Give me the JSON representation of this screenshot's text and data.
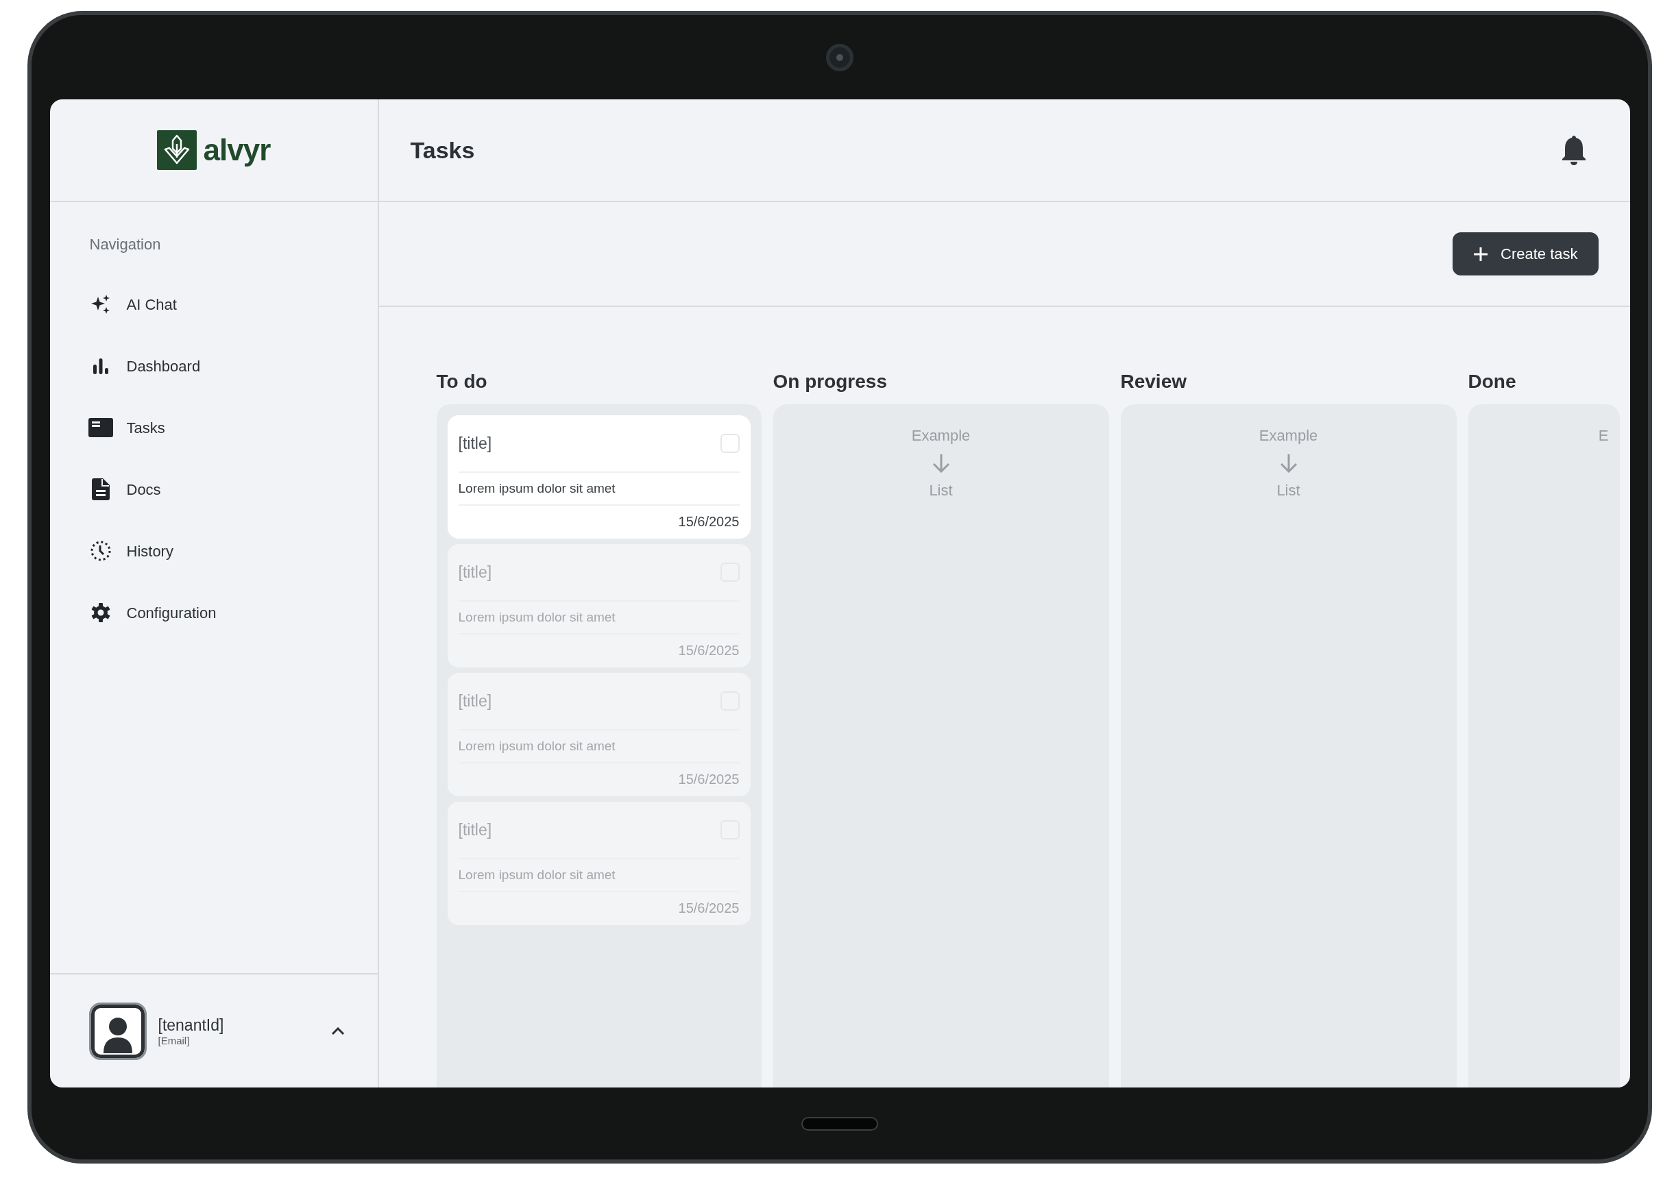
{
  "logo": {
    "text": "alvyr"
  },
  "sidebar": {
    "section_label": "Navigation",
    "items": [
      {
        "label": "AI Chat"
      },
      {
        "label": "Dashboard"
      },
      {
        "label": "Tasks"
      },
      {
        "label": "Docs"
      },
      {
        "label": "History"
      },
      {
        "label": "Configuration"
      }
    ],
    "user": {
      "tenant": "[tenantId]",
      "email": "[Email]"
    }
  },
  "header": {
    "title": "Tasks"
  },
  "toolbar": {
    "button": "Create task"
  },
  "columns": [
    {
      "title": "To do",
      "cards": [
        {
          "title": "[title]",
          "description": "Lorem ipsum dolor sit amet",
          "date": "15/6/2025",
          "checked": false,
          "dimmed": false
        },
        {
          "title": "[title]",
          "description": "Lorem ipsum dolor sit amet",
          "date": "15/6/2025",
          "checked": false,
          "dimmed": true
        },
        {
          "title": "[title]",
          "description": "Lorem ipsum dolor sit amet",
          "date": "15/6/2025",
          "checked": false,
          "dimmed": true
        },
        {
          "title": "[title]",
          "description": "Lorem ipsum dolor sit amet",
          "date": "15/6/2025",
          "checked": false,
          "dimmed": true
        }
      ]
    },
    {
      "title": "On progress",
      "placeholder": {
        "top": "Example",
        "bottom": "List"
      }
    },
    {
      "title": "Review",
      "placeholder": {
        "top": "Example",
        "bottom": "List"
      }
    },
    {
      "title": "Done",
      "placeholder": {
        "top": "E"
      }
    }
  ]
}
